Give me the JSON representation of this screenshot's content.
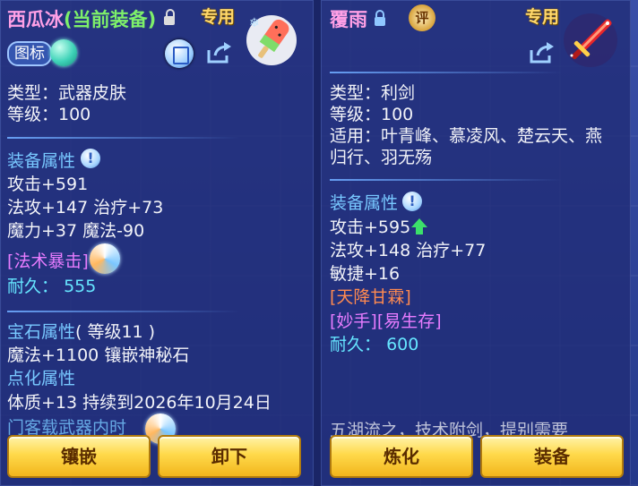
{
  "left_panel": {
    "item_name": "西瓜冰",
    "equipped_tag": "(当前装备)",
    "exclusive_label": "专用",
    "icon_button_label": "图标",
    "type_line": "类型：武器皮肤",
    "level_line": "等级：100",
    "equip_attr_header": "装备属性",
    "attrs": [
      "攻击+591",
      "法攻+147 治疗+73",
      "魔力+37 魔法-90"
    ],
    "special_skill": "[法术暴击]",
    "durability_label": "耐久：",
    "durability_value": "555",
    "gem_header": "宝石属性",
    "gem_level": "( 等级11 )",
    "gem_line": "魔法+1100 镶嵌神秘石",
    "refine_header": "点化属性",
    "refine_line": "体质+13 持续到2026年10月24日",
    "cut_line": "门客载武器内时",
    "btn_inlay": "镶嵌",
    "btn_unequip": "卸下"
  },
  "right_panel": {
    "item_name": "覆雨",
    "badge": "评",
    "exclusive_label": "专用",
    "type_line": "类型：利剑",
    "level_line": "等级：100",
    "fit_line_1": "适用：叶青峰、慕凌风、楚云天、燕",
    "fit_line_2": "归行、羽无殇",
    "equip_attr_header": "装备属性",
    "attr_attack": "攻击+595",
    "attrs": [
      "法攻+148 治疗+77",
      "敏捷+16"
    ],
    "special_1": "[天降甘霖]",
    "special_2": "[妙手][易生存]",
    "durability_label": "耐久：",
    "durability_value": "600",
    "cut_line": "五湖流之，技术附剑，提别需要",
    "btn_refine": "炼化",
    "btn_equip": "装备"
  },
  "colors": {
    "name_pink": "#ffa0e6",
    "equipped_green": "#7ef06a",
    "exclusive_gold": "#ffd86b",
    "section_blue": "#78c8ff",
    "durability_cyan": "#66e6ff",
    "special_magenta": "#e87cff",
    "special_orange": "#ff8a50",
    "button_gold": "#ffd94a"
  }
}
